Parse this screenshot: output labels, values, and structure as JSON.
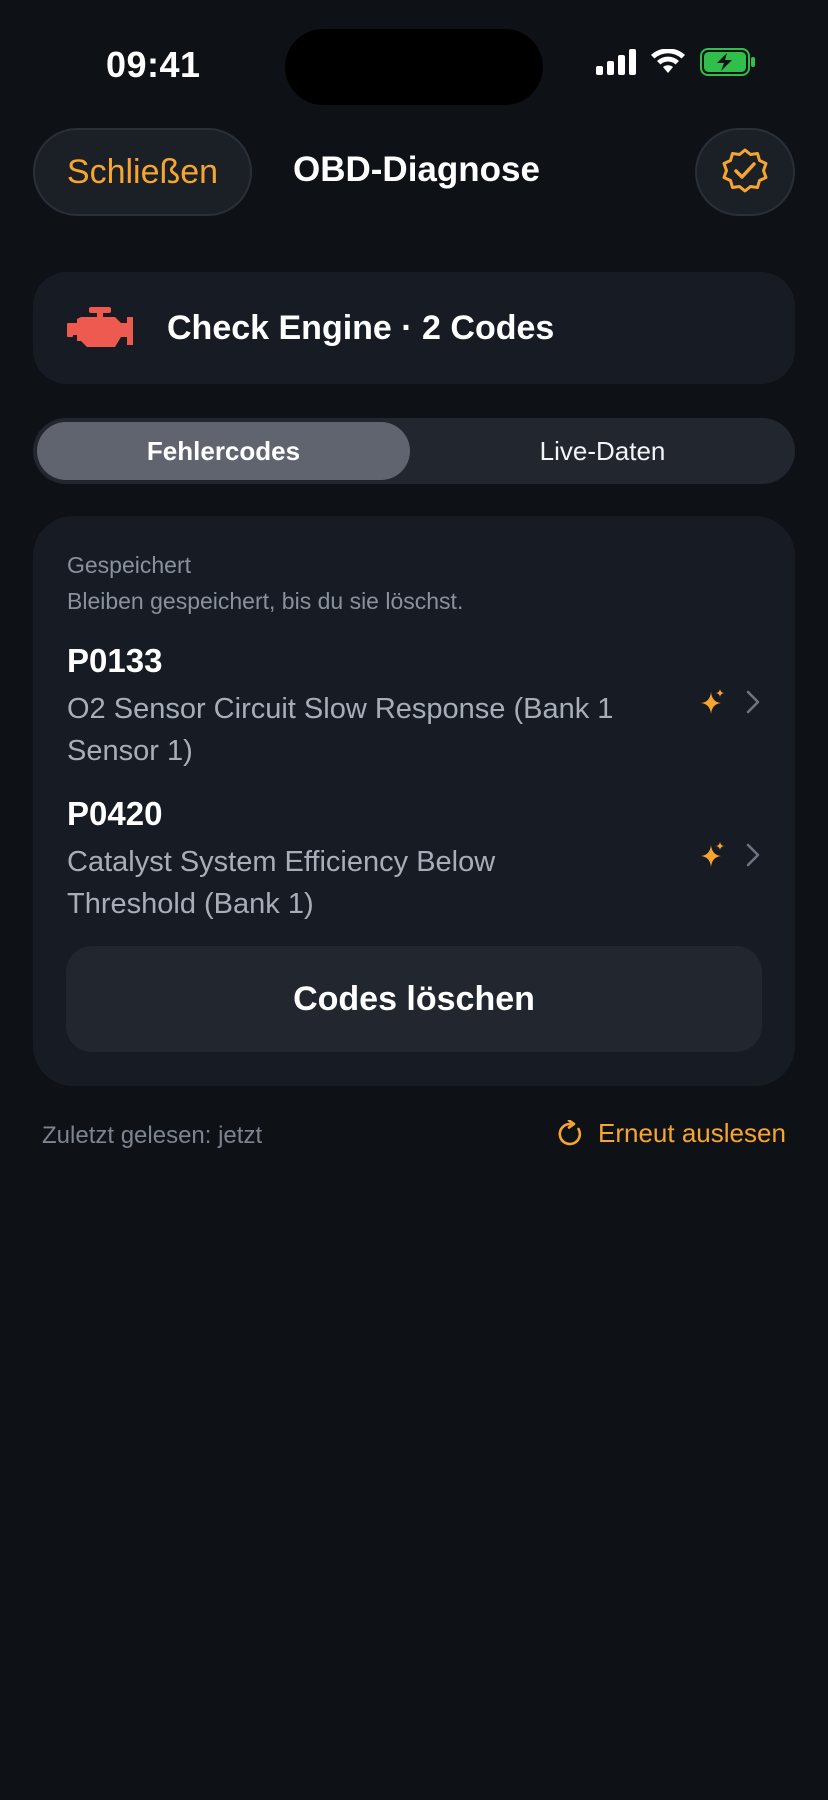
{
  "status_bar": {
    "time": "09:41",
    "icons": [
      "cellular-signal-icon",
      "wifi-icon",
      "battery-charging-icon"
    ]
  },
  "header": {
    "close_label": "Schließen",
    "title": "OBD-Diagnose",
    "verified_icon": "verified-badge-icon"
  },
  "banner": {
    "icon": "check-engine-icon",
    "text": "Check Engine · 2 Codes"
  },
  "tabs": [
    {
      "label": "Fehlercodes",
      "active": true
    },
    {
      "label": "Live-Daten",
      "active": false
    }
  ],
  "codes_section": {
    "title": "Gespeichert",
    "subtitle": "Bleiben gespeichert, bis du sie löschst.",
    "items": [
      {
        "code": "P0133",
        "description": "O2 Sensor Circuit Slow Response (Bank 1 Sensor 1)"
      },
      {
        "code": "P0420",
        "description": "Catalyst System Efficiency Below Threshold (Bank 1)"
      }
    ],
    "clear_label": "Codes löschen"
  },
  "footer": {
    "last_read": "Zuletzt gelesen: jetzt",
    "reread_label": "Erneut auslesen"
  },
  "colors": {
    "accent": "#f7a531",
    "engine_warning": "#ee5a4f",
    "background": "#0e1116",
    "card": "#171c24"
  }
}
